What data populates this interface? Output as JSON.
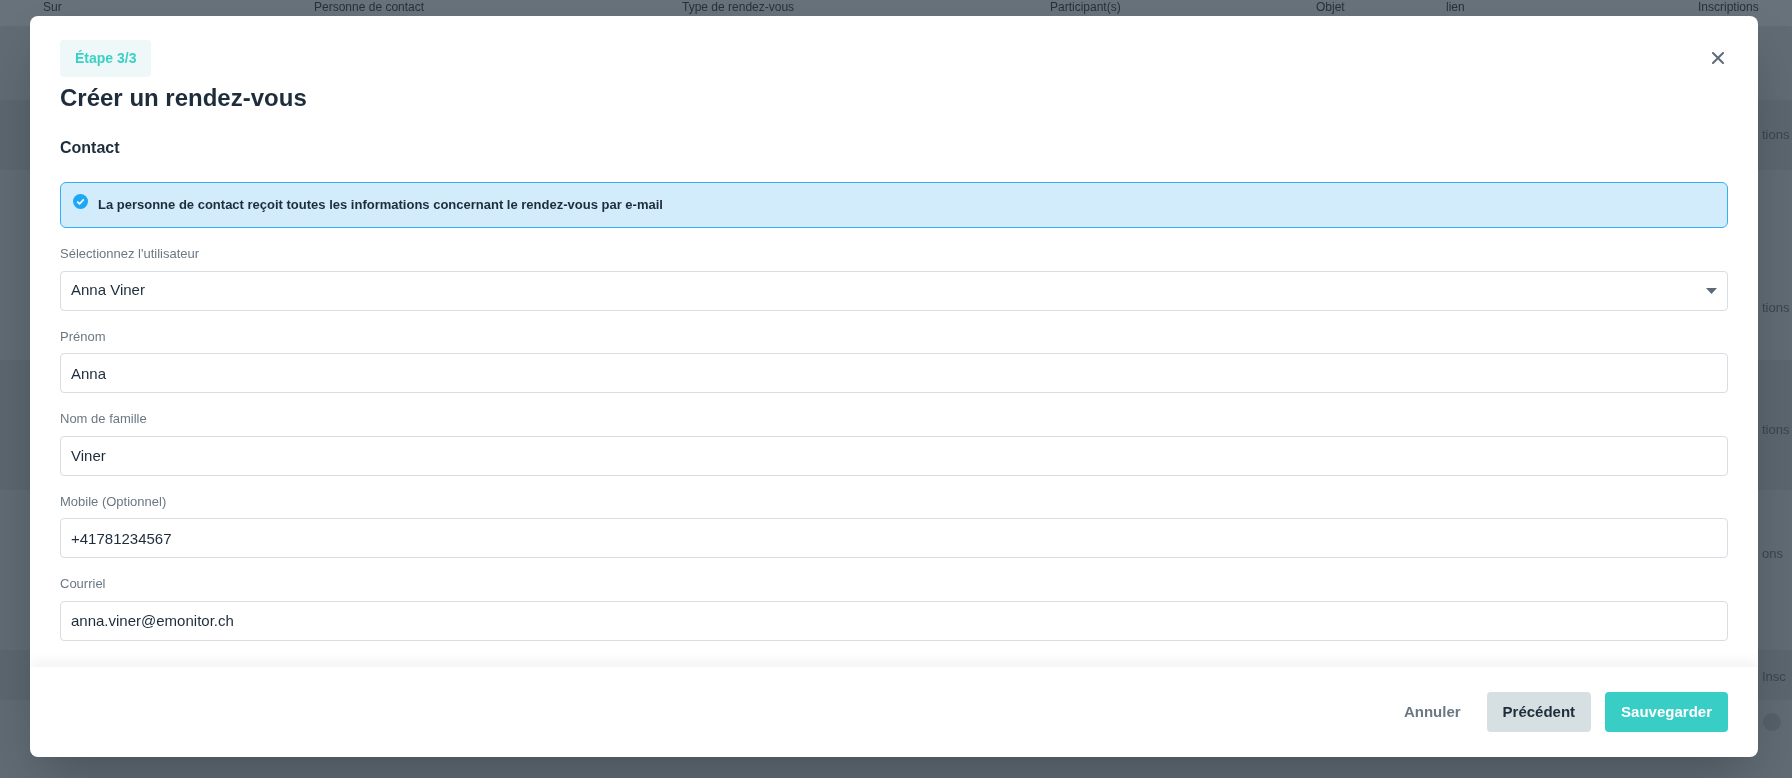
{
  "background_table": {
    "columns": [
      "Sur",
      "Personne de contact",
      "Type de rendez-vous",
      "Participant(s)",
      "Objet",
      "lien",
      "Inscriptions"
    ],
    "row_fragments": [
      "tions",
      "tions",
      "tions",
      "ons",
      "Insc"
    ]
  },
  "modal": {
    "step": "Étape 3/3",
    "title": "Créer un rendez-vous",
    "section": "Contact",
    "info": "La personne de contact reçoit toutes les informations concernant le rendez-vous par e-mail",
    "fields": [
      {
        "kind": "select",
        "label": "Sélectionnez l'utilisateur",
        "value": "Anna Viner"
      },
      {
        "kind": "text",
        "label": "Prénom",
        "value": "Anna"
      },
      {
        "kind": "text",
        "label": "Nom de famille",
        "value": "Viner"
      },
      {
        "kind": "text",
        "label": "Mobile (Optionnel)",
        "value": "+41781234567"
      },
      {
        "kind": "text",
        "label": "Courriel",
        "value": "anna.viner@emonitor.ch"
      }
    ],
    "buttons": [
      {
        "kind": "link",
        "label": "Annuler"
      },
      {
        "kind": "secondary",
        "label": "Précédent"
      },
      {
        "kind": "primary",
        "label": "Sauvegarder"
      }
    ]
  }
}
